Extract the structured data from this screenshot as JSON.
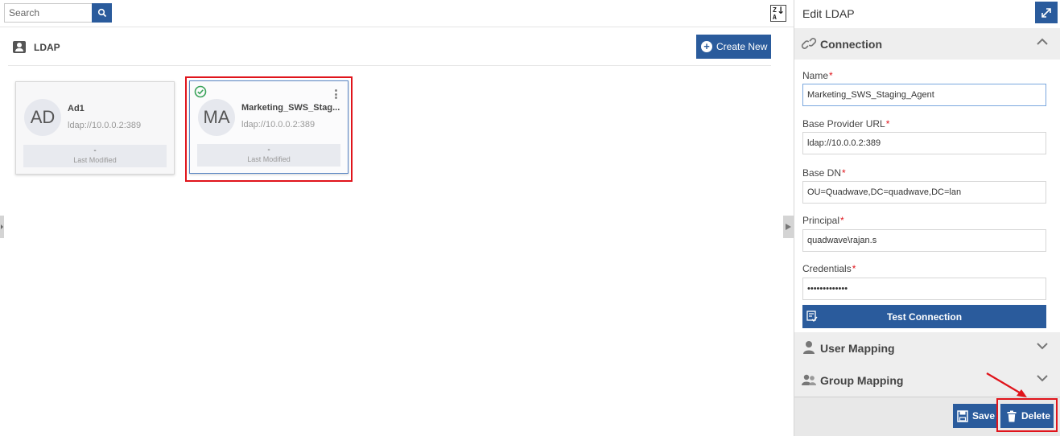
{
  "search": {
    "placeholder": "Search"
  },
  "sort": {
    "top": "Z",
    "bottom": "A"
  },
  "section": {
    "title": "LDAP",
    "create_label": "Create New"
  },
  "cards": [
    {
      "initials": "AD",
      "name": "Ad1",
      "url": "ldap://10.0.0.2:389",
      "modified_value": "-",
      "modified_label": "Last Modified",
      "selected": false
    },
    {
      "initials": "MA",
      "name": "Marketing_SWS_Stag...",
      "url": "ldap://10.0.0.2:389",
      "modified_value": "-",
      "modified_label": "Last Modified",
      "selected": true
    }
  ],
  "panel": {
    "title": "Edit LDAP",
    "sections": {
      "connection": "Connection",
      "user_mapping": "User Mapping",
      "group_mapping": "Group Mapping"
    },
    "fields": {
      "name": {
        "label": "Name",
        "value": "Marketing_SWS_Staging_Agent"
      },
      "base_provider_url": {
        "label": "Base Provider URL",
        "value": "ldap://10.0.0.2:389"
      },
      "base_dn": {
        "label": "Base DN",
        "value": "OU=Quadwave,DC=quadwave,DC=lan"
      },
      "principal": {
        "label": "Principal",
        "value": "quadwave\\rajan.s"
      },
      "credentials": {
        "label": "Credentials",
        "value": "•••••••••••••"
      }
    },
    "required_mark": "*",
    "test_connection_label": "Test Connection",
    "save_label": "Save",
    "delete_label": "Delete"
  },
  "colors": {
    "primary": "#2a5b9c",
    "highlight": "#e0141b",
    "success": "#3aa35a"
  }
}
